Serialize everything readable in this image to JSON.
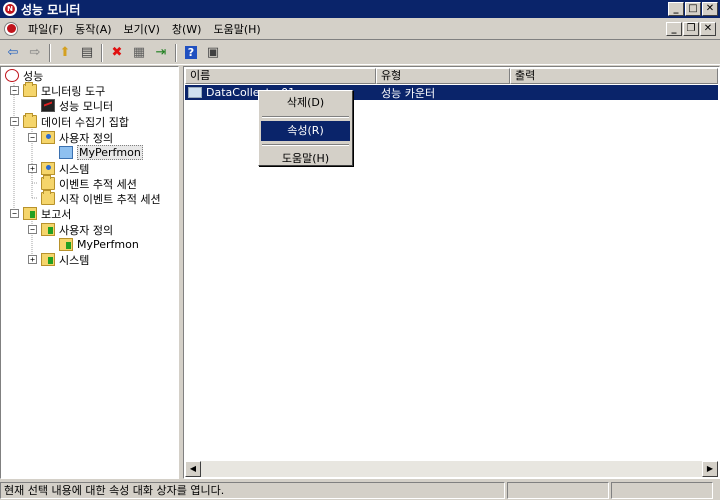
{
  "window": {
    "title": "성능 모니터",
    "minimize": "_",
    "maximize": "□",
    "close": "✕"
  },
  "menu": {
    "items": [
      {
        "label": "파일(F)"
      },
      {
        "label": "동작(A)"
      },
      {
        "label": "보기(V)"
      },
      {
        "label": "창(W)"
      },
      {
        "label": "도움말(H)"
      }
    ],
    "doc_minimize": "_",
    "doc_restore": "❐",
    "doc_close": "✕"
  },
  "toolbar": {
    "buttons": [
      {
        "icon": "back-arrow-icon",
        "glyph": "⇦",
        "color": "#2060c0"
      },
      {
        "icon": "forward-arrow-icon",
        "glyph": "⇨",
        "color": "#808080"
      },
      {
        "icon": "up-folder-icon",
        "glyph": "⬆",
        "color": "#d4a020"
      },
      {
        "icon": "show-hide-tree-icon",
        "glyph": "▤",
        "color": "#404040"
      },
      {
        "icon": "delete-icon",
        "glyph": "✖",
        "color": "#e01010"
      },
      {
        "icon": "properties-icon",
        "glyph": "▦",
        "color": "#606060"
      },
      {
        "icon": "export-list-icon",
        "glyph": "⇥",
        "color": "#208020"
      },
      {
        "icon": "help-icon",
        "glyph": "?",
        "color": "#ffffff"
      },
      {
        "icon": "view-icon",
        "glyph": "▣",
        "color": "#404040"
      }
    ]
  },
  "tree": {
    "root": "성능",
    "nodes": [
      {
        "id": "monitoring-tools",
        "label": "모니터링 도구",
        "expander": "−"
      },
      {
        "id": "perf-monitor",
        "label": "성능 모니터"
      },
      {
        "id": "data-collector-sets",
        "label": "데이터 수집기 집합",
        "expander": "−"
      },
      {
        "id": "user-defined",
        "label": "사용자 정의",
        "expander": "−"
      },
      {
        "id": "myperfmon",
        "label": "MyPerfmon"
      },
      {
        "id": "system",
        "label": "시스템",
        "expander": "+"
      },
      {
        "id": "event-trace",
        "label": "이벤트 추적 세션"
      },
      {
        "id": "startup-event-trace",
        "label": "시작 이벤트 추적 세션"
      },
      {
        "id": "reports",
        "label": "보고서",
        "expander": "−"
      },
      {
        "id": "reports-user-defined",
        "label": "사용자 정의",
        "expander": "−"
      },
      {
        "id": "reports-myperfmon",
        "label": "MyPerfmon"
      },
      {
        "id": "reports-system",
        "label": "시스템",
        "expander": "+"
      }
    ]
  },
  "list": {
    "columns": [
      "이름",
      "유형",
      "출력"
    ],
    "rows": [
      {
        "name": "DataCollector01",
        "type": "성능 카운터",
        "output": ""
      }
    ]
  },
  "context_menu": {
    "items": [
      {
        "label": "삭제(D)"
      },
      {
        "label": "속성(R)",
        "highlighted": true
      },
      {
        "label": "도움말(H)"
      }
    ]
  },
  "status": {
    "text": "현재 선택 내용에 대한 속성 대화 상자를 엽니다."
  },
  "colors": {
    "titlebar": "#0a246a",
    "face": "#d4d0c8",
    "selection": "#0a246a"
  }
}
